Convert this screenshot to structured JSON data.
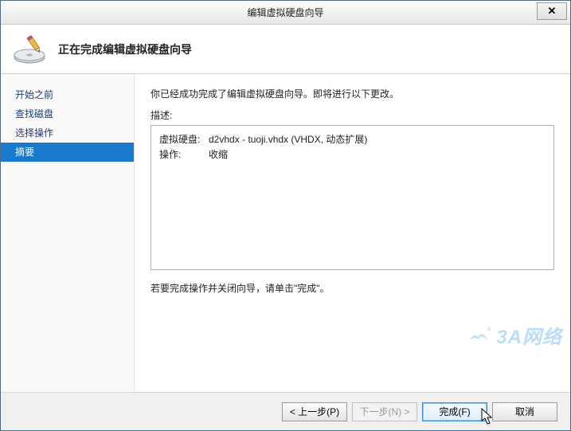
{
  "window": {
    "title": "编辑虚拟硬盘向导",
    "close_glyph": "✕"
  },
  "header": {
    "title": "正在完成编辑虚拟硬盘向导"
  },
  "sidebar": {
    "items": [
      {
        "label": "开始之前"
      },
      {
        "label": "查找磁盘"
      },
      {
        "label": "选择操作"
      },
      {
        "label": "摘要"
      }
    ],
    "selected_index": 3
  },
  "main": {
    "intro": "你已经成功完成了编辑虚拟硬盘向导。即将进行以下更改。",
    "description_label": "描述:",
    "summary": {
      "vhd_label": "虚拟硬盘:",
      "vhd_value": "d2vhdx - tuoji.vhdx (VHDX, 动态扩展)",
      "op_label": "操作:",
      "op_value": "收缩"
    },
    "finish_hint": "若要完成操作并关闭向导，请单击\"完成\"。"
  },
  "footer": {
    "prev": "< 上一步(P)",
    "next": "下一步(N) >",
    "finish": "完成(F)",
    "cancel": "取消"
  },
  "watermark": "3A网络"
}
